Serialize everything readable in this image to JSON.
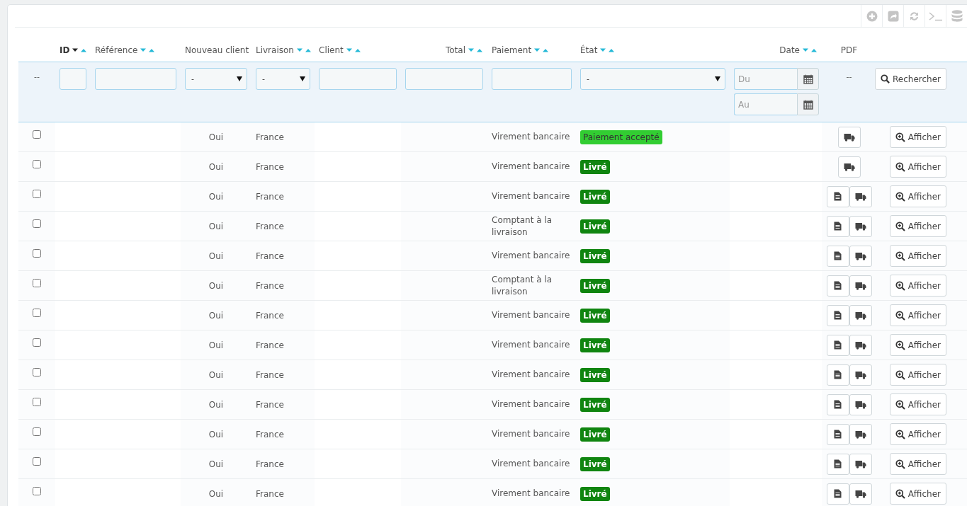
{
  "toolbar": [
    {
      "kind": "add"
    },
    {
      "kind": "export"
    },
    {
      "kind": "refresh"
    },
    {
      "kind": "sql"
    },
    {
      "kind": "database"
    }
  ],
  "columns": [
    {
      "label": "ID",
      "sortable": true,
      "sorted": true
    },
    {
      "label": "Référence",
      "sortable": true,
      "sorted": false
    },
    {
      "label": "Nouveau client",
      "sortable": false,
      "sorted": false
    },
    {
      "label": "Livraison",
      "sortable": true,
      "sorted": false
    },
    {
      "label": "Client",
      "sortable": true,
      "sorted": false
    },
    {
      "label": "Total",
      "sortable": true,
      "sorted": false
    },
    {
      "label": "Paiement",
      "sortable": true,
      "sorted": false
    },
    {
      "label": "État",
      "sortable": true,
      "sorted": false
    },
    {
      "label": "Date",
      "sortable": true,
      "sorted": false
    },
    {
      "label": "PDF",
      "sortable": false,
      "sorted": false
    }
  ],
  "filters": {
    "checkbox_col": "--",
    "nouveau_client": "-",
    "livraison": "-",
    "etat": "-",
    "date_from_placeholder": "Du",
    "date_to_placeholder": "Au",
    "pdf": "--",
    "search_button": "Rechercher"
  },
  "rows": [
    {
      "checked": false,
      "nouveau_client": "Oui",
      "livraison": "France",
      "paiement": "Virement bancaire",
      "etat": "Paiement accepté",
      "color": "#32cd32",
      "invoice": false,
      "action": "Afficher"
    },
    {
      "checked": false,
      "nouveau_client": "Oui",
      "livraison": "France",
      "paiement": "Virement bancaire",
      "etat": "Livré",
      "color": "#108510",
      "invoice": false,
      "action": "Afficher"
    },
    {
      "checked": false,
      "nouveau_client": "Oui",
      "livraison": "France",
      "paiement": "Virement bancaire",
      "etat": "Livré",
      "color": "#108510",
      "invoice": true,
      "action": "Afficher"
    },
    {
      "checked": false,
      "nouveau_client": "Oui",
      "livraison": "France",
      "paiement": "Comptant à la livraison",
      "etat": "Livré",
      "color": "#108510",
      "invoice": true,
      "action": "Afficher"
    },
    {
      "checked": false,
      "nouveau_client": "Oui",
      "livraison": "France",
      "paiement": "Virement bancaire",
      "etat": "Livré",
      "color": "#108510",
      "invoice": true,
      "action": "Afficher"
    },
    {
      "checked": false,
      "nouveau_client": "Oui",
      "livraison": "France",
      "paiement": "Comptant à la livraison",
      "etat": "Livré",
      "color": "#108510",
      "invoice": true,
      "action": "Afficher"
    },
    {
      "checked": false,
      "nouveau_client": "Oui",
      "livraison": "France",
      "paiement": "Virement bancaire",
      "etat": "Livré",
      "color": "#108510",
      "invoice": true,
      "action": "Afficher"
    },
    {
      "checked": false,
      "nouveau_client": "Oui",
      "livraison": "France",
      "paiement": "Virement bancaire",
      "etat": "Livré",
      "color": "#108510",
      "invoice": true,
      "action": "Afficher"
    },
    {
      "checked": false,
      "nouveau_client": "Oui",
      "livraison": "France",
      "paiement": "Virement bancaire",
      "etat": "Livré",
      "color": "#108510",
      "invoice": true,
      "action": "Afficher"
    },
    {
      "checked": false,
      "nouveau_client": "Oui",
      "livraison": "France",
      "paiement": "Virement bancaire",
      "etat": "Livré",
      "color": "#108510",
      "invoice": true,
      "action": "Afficher"
    },
    {
      "checked": false,
      "nouveau_client": "Oui",
      "livraison": "France",
      "paiement": "Virement bancaire",
      "etat": "Livré",
      "color": "#108510",
      "invoice": true,
      "action": "Afficher"
    },
    {
      "checked": false,
      "nouveau_client": "Oui",
      "livraison": "France",
      "paiement": "Virement bancaire",
      "etat": "Livré",
      "color": "#108510",
      "invoice": true,
      "action": "Afficher"
    },
    {
      "checked": false,
      "nouveau_client": "Oui",
      "livraison": "France",
      "paiement": "Virement bancaire",
      "etat": "Livré",
      "color": "#108510",
      "invoice": true,
      "action": "Afficher"
    }
  ]
}
